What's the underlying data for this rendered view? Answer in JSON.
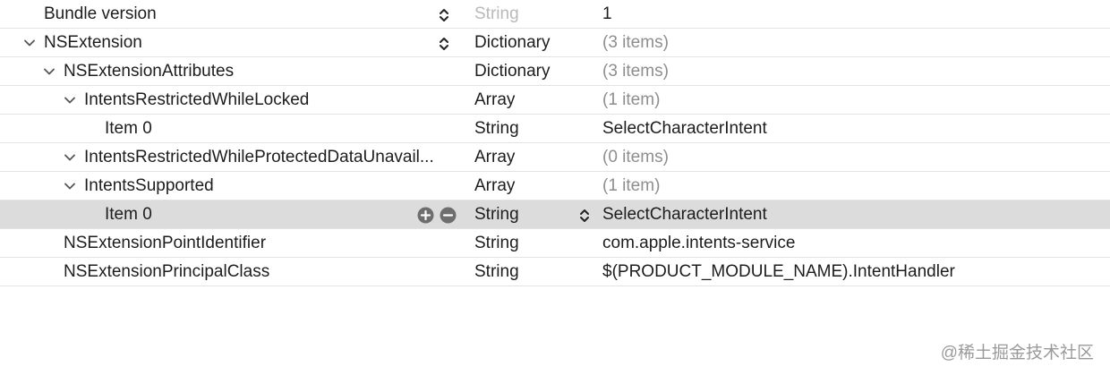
{
  "rows": [
    {
      "key": "Bundle version",
      "type": "String",
      "value": "1"
    },
    {
      "key": "NSExtension",
      "type": "Dictionary",
      "value": "(3 items)"
    },
    {
      "key": "NSExtensionAttributes",
      "type": "Dictionary",
      "value": "(3 items)"
    },
    {
      "key": "IntentsRestrictedWhileLocked",
      "type": "Array",
      "value": "(1 item)"
    },
    {
      "key": "Item 0",
      "type": "String",
      "value": "SelectCharacterIntent"
    },
    {
      "key": "IntentsRestrictedWhileProtectedDataUnavail...",
      "type": "Array",
      "value": "(0 items)"
    },
    {
      "key": "IntentsSupported",
      "type": "Array",
      "value": "(1 item)"
    },
    {
      "key": "Item 0",
      "type": "String",
      "value": "SelectCharacterIntent"
    },
    {
      "key": "NSExtensionPointIdentifier",
      "type": "String",
      "value": "com.apple.intents-service"
    },
    {
      "key": "NSExtensionPrincipalClass",
      "type": "String",
      "value": "$(PRODUCT_MODULE_NAME).IntentHandler"
    }
  ],
  "watermark": "@稀土掘金技术社区",
  "icons": {
    "expand": "chevron-down-icon",
    "type_stepper": "stepper-icon",
    "add": "plus-circle-icon",
    "remove": "minus-circle-icon"
  },
  "colors": {
    "selected_row": "#dcdcdc",
    "dim_text": "#8e8e8e"
  }
}
